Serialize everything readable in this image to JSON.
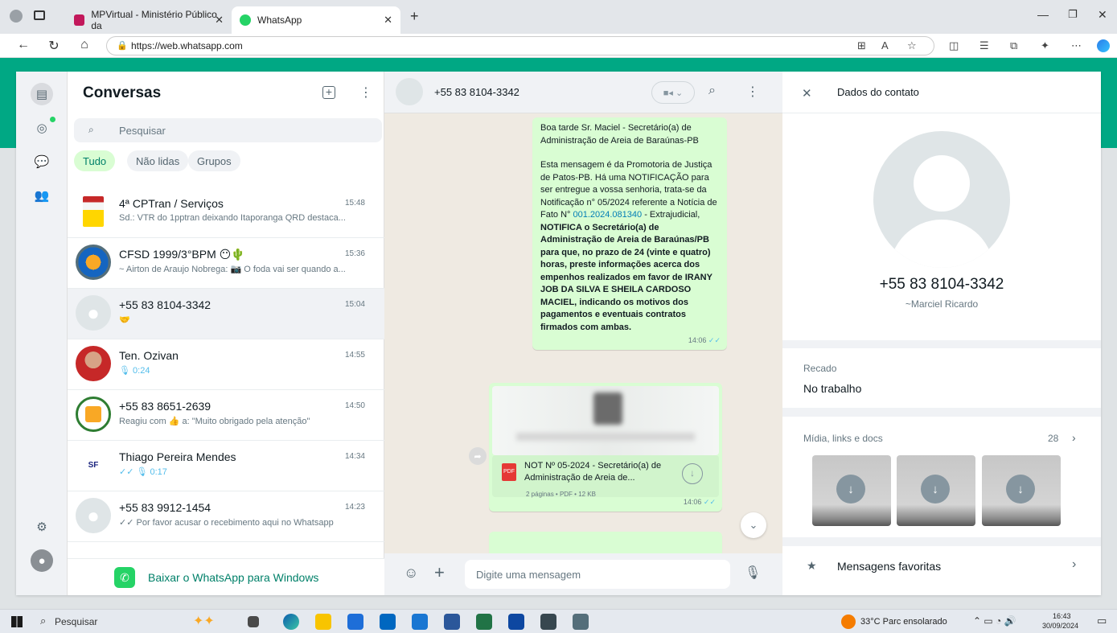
{
  "browser": {
    "tabs": [
      {
        "label": "MPVirtual - Ministério Público da"
      },
      {
        "label": "WhatsApp"
      }
    ],
    "url": "https://web.whatsapp.com"
  },
  "sidebar": {
    "title": "Conversas",
    "search_placeholder": "Pesquisar",
    "filters": [
      "Tudo",
      "Não lidas",
      "Grupos"
    ],
    "chats": [
      {
        "name": "4ª CPTran / Serviços",
        "time": "15:48",
        "preview": "Sd.: VTR do 1pptran deixando Itaporanga QRD destaca..."
      },
      {
        "name": "CFSD 1999/3°BPM",
        "time": "15:36",
        "preview": "~ Airton de Araujo Nobrega: 📷 O foda vai ser quando a..."
      },
      {
        "name": "+55 83 8104-3342",
        "time": "15:04",
        "preview": "🤝"
      },
      {
        "name": "Ten. Ozivan",
        "time": "14:55",
        "preview": "🎙 0:24"
      },
      {
        "name": "+55 83 8651-2639",
        "time": "14:50",
        "preview": "Reagiu com 👍 a: \"Muito obrigado pela atenção\""
      },
      {
        "name": "Thiago Pereira Mendes",
        "time": "14:34",
        "preview": "✓✓ 🎙 0:17"
      },
      {
        "name": "+55 83 9912-1454",
        "time": "14:23",
        "preview": "✓✓ Por favor acusar o recebimento aqui no Whatsapp"
      }
    ],
    "download_label": "Baixar o WhatsApp para Windows"
  },
  "conversation": {
    "contact": "+55 83 8104-3342",
    "message": {
      "line1": "Boa tarde Sr. Maciel - Secretário(a) de Administração de Areia de Baraúnas-PB",
      "line2": "Esta mensagem é da Promotoria de Justiça de Patos-PB. Há uma NOTIFICAÇÃO para ser entregue a vossa senhoria, trata-se da Notificação n° 05/2024 referente a Notícia de Fato N°",
      "link": "001.2024.081340",
      "line3": " - Extrajudicial,",
      "bold": "NOTIFICA o Secretário(a) de Administração de Areia de Baraúnas/PB para que, no prazo de 24 (vinte e quatro) horas, preste informações acerca dos empenhos realizados em favor de IRANY JOB DA SILVA E SHEILA CARDOSO MACIEL, indicando os motivos dos pagamentos e eventuais contratos firmados com ambas.",
      "time": "14:06"
    },
    "document": {
      "name": "NOT Nº 05-2024 - Secretário(a) de Administração de Areia de...",
      "meta": "2 páginas • PDF • 12 KB",
      "time": "14:06"
    },
    "input_placeholder": "Digite uma mensagem"
  },
  "contact_info": {
    "title": "Dados do contato",
    "phone": "+55 83 8104-3342",
    "alias": "~Marciel Ricardo",
    "status_label": "Recado",
    "status_value": "No trabalho",
    "media_label": "Mídia, links e docs",
    "media_count": "28",
    "starred_label": "Mensagens favoritas"
  },
  "taskbar": {
    "search": "Pesquisar",
    "weather": "33°C  Parc ensolarado",
    "time": "16:43",
    "date": "30/09/2024"
  },
  "colors": {
    "accent": "#00a884",
    "bubble": "#d9fdd3",
    "link": "#027eb5"
  }
}
